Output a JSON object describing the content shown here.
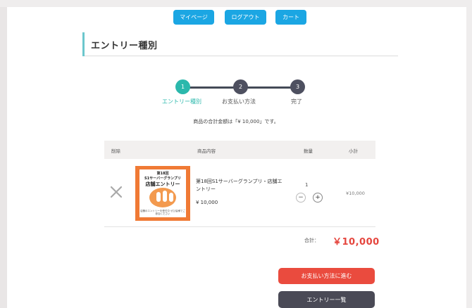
{
  "nav": {
    "mypage": "マイページ",
    "logout": "ログアウト",
    "cart": "カート"
  },
  "page": {
    "title": "エントリー種別"
  },
  "steps": [
    {
      "number": "1",
      "label": "エントリー種別",
      "state": "active"
    },
    {
      "number": "2",
      "label": "お支払い方法",
      "state": "todo"
    },
    {
      "number": "3",
      "label": "完了",
      "state": "todo"
    }
  ],
  "total_message": "商品の合計金額は「¥ 10,000」です。",
  "table": {
    "headers": {
      "delete": "削除",
      "product": "商品内容",
      "quantity": "数量",
      "subtotal": "小計"
    },
    "items": [
      {
        "thumbnail": {
          "line1": "第18回",
          "line2": "S1サーバーグランプリ",
          "line3": "店舗エントリー",
          "caption": "店舗のエントリーを受付中 ぜひ皆様でご参加ください"
        },
        "name": "第18回S1サーバーグランプリ・店舗エントリー",
        "price": "¥ 10,000",
        "quantity": "1",
        "subtotal": "¥10,000"
      }
    ]
  },
  "summary": {
    "label": "合計：",
    "value": "￥10,000"
  },
  "buttons": {
    "next": "お支払い方法に進む",
    "list": "エントリー一覧"
  },
  "colors": {
    "nav": "#1ba6e3",
    "step_active": "#2bb8ac",
    "step_todo": "#4e5060",
    "total": "#e5463e",
    "next_button": "#ea4b3e",
    "list_button": "#4a4a56",
    "thumbnail": "#f07a35"
  }
}
